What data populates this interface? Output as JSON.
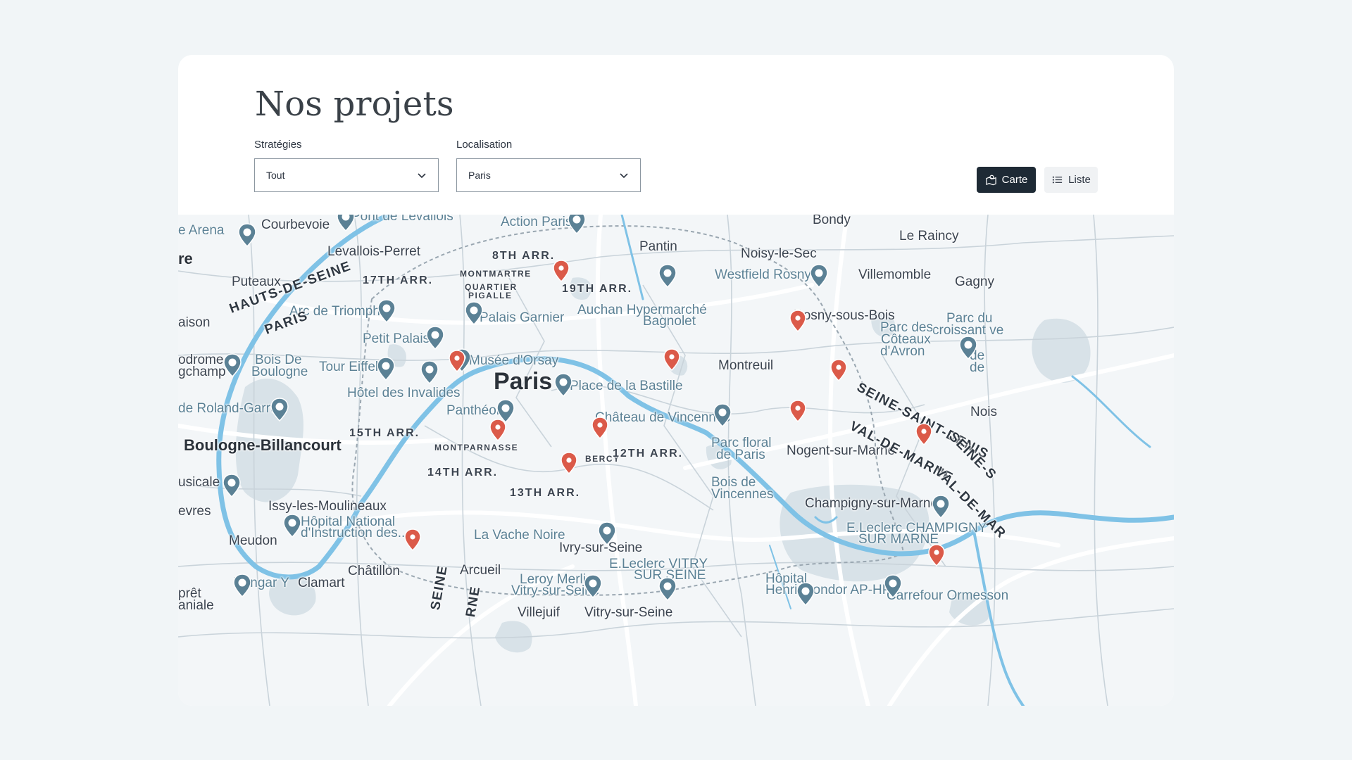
{
  "header": {
    "title": "Nos projets"
  },
  "filters": {
    "strategies": {
      "label": "Stratégies",
      "value": "Tout"
    },
    "localisation": {
      "label": "Localisation",
      "value": "Paris"
    }
  },
  "view_toggle": {
    "map_label": "Carte",
    "list_label": "Liste"
  },
  "colors": {
    "pin": "#db5a49",
    "poi": "#5b8195",
    "water": "#7fc2e6",
    "dark_button": "#1e2a35"
  },
  "map": {
    "labels": [
      {
        "t": "e Arena",
        "k": "poi"
      },
      {
        "t": "Courbevoie",
        "k": ""
      },
      {
        "t": "Pont de Levallois",
        "k": "poi"
      },
      {
        "t": "Action Paris",
        "k": "poi"
      },
      {
        "t": "Bondy",
        "k": ""
      },
      {
        "t": "Le Raincy",
        "k": ""
      },
      {
        "t": "re",
        "k": "bold"
      },
      {
        "t": "Levallois-Perret",
        "k": ""
      },
      {
        "t": "8TH ARR.",
        "k": "arr"
      },
      {
        "t": "Pantin",
        "k": ""
      },
      {
        "t": "Noisy-le-Sec",
        "k": ""
      },
      {
        "t": "Westfield Rosny 2",
        "k": "poi"
      },
      {
        "t": "Villemomble",
        "k": ""
      },
      {
        "t": "Gagny",
        "k": ""
      },
      {
        "t": "Puteaux",
        "k": ""
      },
      {
        "t": "17TH ARR.",
        "k": "arr"
      },
      {
        "t": "MONTMARTRE",
        "k": "small"
      },
      {
        "t": "QUARTIER",
        "k": "small"
      },
      {
        "t": "PIGALLE",
        "k": "small"
      },
      {
        "t": "19TH ARR.",
        "k": "arr"
      },
      {
        "t": "Auchan Hypermarché",
        "k": "poi"
      },
      {
        "t": "Bagnolet",
        "k": "poi"
      },
      {
        "t": "Arc de Triomphe",
        "k": "poi"
      },
      {
        "t": "Palais Garnier",
        "k": "poi"
      },
      {
        "t": "Rosny-sous-Bois",
        "k": ""
      },
      {
        "t": "Parc du",
        "k": "poi"
      },
      {
        "t": "croissant ve",
        "k": "poi"
      },
      {
        "t": "aison",
        "k": ""
      },
      {
        "t": "Parc des",
        "k": "poi"
      },
      {
        "t": "Côteaux",
        "k": "poi"
      },
      {
        "t": "d'Avron",
        "k": "poi"
      },
      {
        "t": "Petit Palais",
        "k": "poi"
      },
      {
        "t": "Musée d'Orsay",
        "k": "poi"
      },
      {
        "t": "Montreuil",
        "k": ""
      },
      {
        "t": "odrome",
        "k": ""
      },
      {
        "t": "gchamp",
        "k": ""
      },
      {
        "t": "Bois De",
        "k": "poi"
      },
      {
        "t": "Boulogne",
        "k": "poi"
      },
      {
        "t": "Tour Eiffel",
        "k": "poi"
      },
      {
        "t": "Paris",
        "k": "big"
      },
      {
        "t": "Place de la Bastille",
        "k": "poi"
      },
      {
        "t": "de",
        "k": "poi"
      },
      {
        "t": "de",
        "k": "poi"
      },
      {
        "t": "Hôtel des Invalides",
        "k": "poi"
      },
      {
        "t": "de Roland-Garros",
        "k": "poi"
      },
      {
        "t": "Panthéon",
        "k": "poi"
      },
      {
        "t": "Château de Vincennes",
        "k": "poi"
      },
      {
        "t": "Nois",
        "k": ""
      },
      {
        "t": "Boulogne-Billancourt",
        "k": "bold"
      },
      {
        "t": "15TH ARR.",
        "k": "arr"
      },
      {
        "t": "MONTPARNASSE",
        "k": "small"
      },
      {
        "t": "Parc floral",
        "k": "poi"
      },
      {
        "t": "de Paris",
        "k": "poi"
      },
      {
        "t": "Nogent-sur-Marne",
        "k": ""
      },
      {
        "t": "BERCY",
        "k": "small"
      },
      {
        "t": "12TH ARR.",
        "k": "arr"
      },
      {
        "t": "14TH ARR.",
        "k": "arr"
      },
      {
        "t": "Bois de",
        "k": "poi"
      },
      {
        "t": "Vincennes",
        "k": "poi"
      },
      {
        "t": "usicale",
        "k": ""
      },
      {
        "t": "13TH ARR.",
        "k": "arr"
      },
      {
        "t": "Champigny-sur-Marne",
        "k": ""
      },
      {
        "t": "evres",
        "k": ""
      },
      {
        "t": "Issy-les-Moulineaux",
        "k": ""
      },
      {
        "t": "Hôpital National",
        "k": "poi"
      },
      {
        "t": "d'Instruction des...",
        "k": "poi"
      },
      {
        "t": "E.Leclerc CHAMPIGNY",
        "k": "poi"
      },
      {
        "t": "SUR MARNE",
        "k": "poi"
      },
      {
        "t": "La Vache Noire",
        "k": "poi"
      },
      {
        "t": "Meudon",
        "k": ""
      },
      {
        "t": "Ivry-sur-Seine",
        "k": ""
      },
      {
        "t": "E.Leclerc VITRY",
        "k": "poi"
      },
      {
        "t": "SUR SEINE",
        "k": "poi"
      },
      {
        "t": "Châtillon",
        "k": ""
      },
      {
        "t": "Arcueil",
        "k": ""
      },
      {
        "t": "Leroy Merlin",
        "k": "poi"
      },
      {
        "t": "Vitry-sur-Seine",
        "k": "poi"
      },
      {
        "t": "Hôpital",
        "k": "poi"
      },
      {
        "t": "Henri-Mondor AP-HP",
        "k": "poi"
      },
      {
        "t": "Hangar Y",
        "k": "poi"
      },
      {
        "t": "Clamart",
        "k": ""
      },
      {
        "t": "Carrefour Ormesson",
        "k": "poi"
      },
      {
        "t": "prêt",
        "k": ""
      },
      {
        "t": "aniale",
        "k": ""
      },
      {
        "t": "Villejuif",
        "k": ""
      },
      {
        "t": "Vitry-sur-Seine",
        "k": ""
      },
      {
        "t": "HAUTS-DE-SEINE",
        "k": "dept"
      },
      {
        "t": "PARIS",
        "k": "dept"
      },
      {
        "t": "SEINE-SAINT-DENIS",
        "k": "dept"
      },
      {
        "t": "VAL-DE-MARNE",
        "k": "dept"
      },
      {
        "t": "SEINE-S",
        "k": "dept"
      },
      {
        "t": "VAL-DE-MAR",
        "k": "dept"
      },
      {
        "t": "SEINE",
        "k": "dept"
      },
      {
        "t": "RNE",
        "k": "dept"
      }
    ]
  }
}
